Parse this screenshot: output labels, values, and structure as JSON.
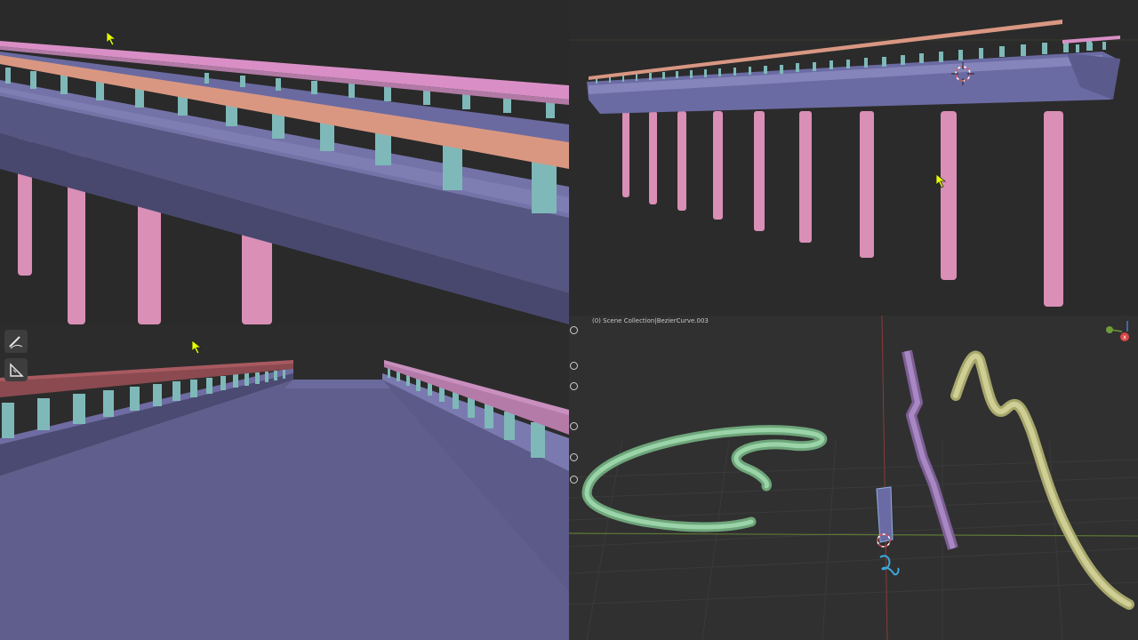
{
  "viewport_bottom_right": {
    "header": {
      "collection": "(0) Scene Collection",
      "separator": " | ",
      "object_name": "BezierCurve.003"
    }
  },
  "icons": [
    "annotate-tool-icon",
    "measure-tool-icon",
    "mouse-cursor-icon",
    "3d-cursor-icon",
    "navigation-gizmo-icon"
  ],
  "colors": {
    "viewport_bg": "#2b2b2b",
    "deck": "#6e6c9e",
    "posts": "#d98fb6",
    "baluster": "#7fb8b8",
    "handrail_orange": "#d99782",
    "handrail_pink": "#d98fc6",
    "curve_green": "#8cc79a",
    "curve_purple": "#9c7ab3",
    "curve_yellow": "#c9c98c"
  }
}
